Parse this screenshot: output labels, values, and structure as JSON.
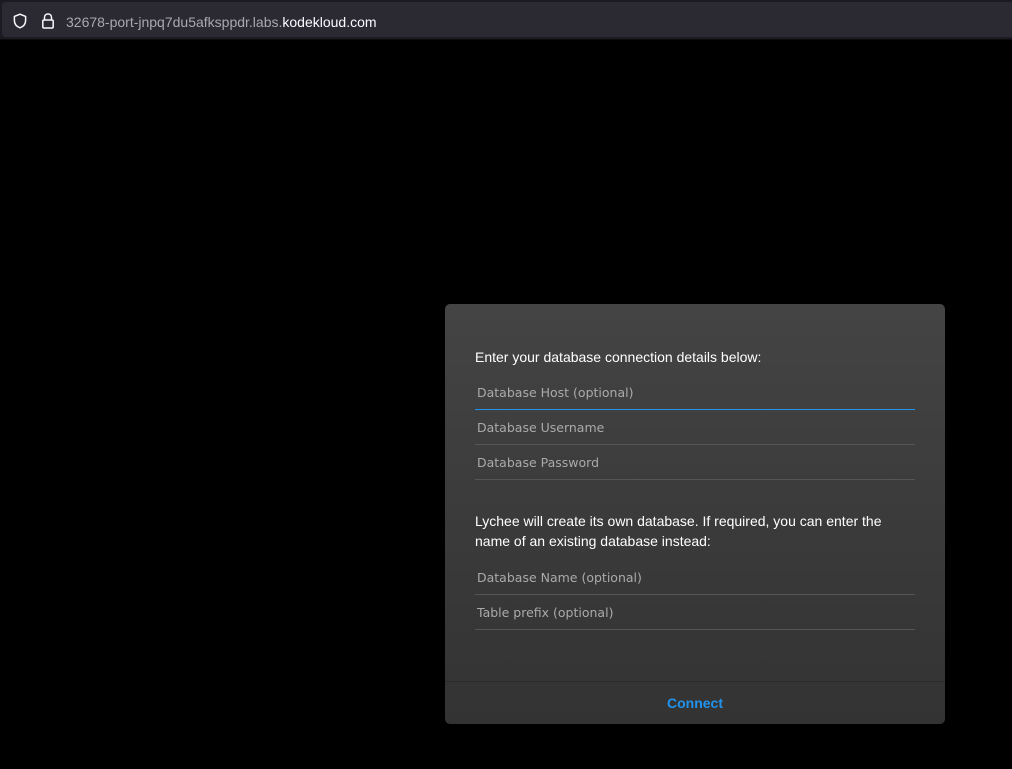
{
  "browser": {
    "url_prefix": "32678-port-jnpq7du5afksppdr.labs.",
    "url_domain": "kodekloud.com",
    "icons": [
      "shield-icon",
      "lock-icon"
    ]
  },
  "dialog": {
    "intro": "Enter your database connection details below:",
    "fields_connection": [
      {
        "placeholder": "Database Host (optional)",
        "value": ""
      },
      {
        "placeholder": "Database Username",
        "value": ""
      },
      {
        "placeholder": "Database Password",
        "value": ""
      }
    ],
    "secondary_text": "Lychee will create its own database. If required, you can enter the name of an existing database instead:",
    "fields_database": [
      {
        "placeholder": "Database Name (optional)",
        "value": ""
      },
      {
        "placeholder": "Table prefix (optional)",
        "value": ""
      }
    ],
    "connect_label": "Connect"
  },
  "colors": {
    "accent": "#2293ec",
    "page_background": "#000000",
    "dialog_background": "#3c3c3c"
  }
}
